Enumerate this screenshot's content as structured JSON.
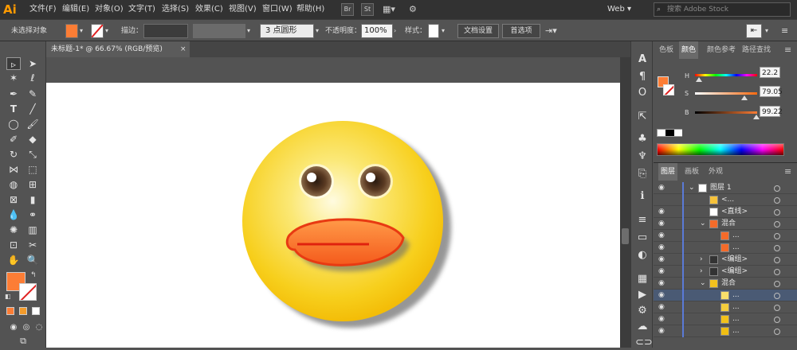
{
  "app": {
    "logo": "Ai"
  },
  "menu": [
    "文件(F)",
    "编辑(E)",
    "对象(O)",
    "文字(T)",
    "选择(S)",
    "效果(C)",
    "视图(V)",
    "窗口(W)",
    "帮助(H)"
  ],
  "menu_buttons": [
    "Br",
    "St"
  ],
  "workspace": "Web",
  "search_placeholder": "搜索 Adobe Stock",
  "control": {
    "selection": "未选择对象",
    "stroke_label": "描边：",
    "brush_profile": "3 点圆形",
    "opacity_label": "不透明度：",
    "opacity_value": "100%",
    "style_label": "样式：",
    "doc_setup": "文档设置",
    "preferences": "首选项"
  },
  "doc_tab": "未标题-1* @ 66.67% (RGB/预览)",
  "color_panel": {
    "tabs": [
      "色板",
      "颜色",
      "颜色参考",
      "路径查找"
    ],
    "H": {
      "label": "H",
      "value": "22.2",
      "pos": 0.06
    },
    "S": {
      "label": "S",
      "value": "79.05",
      "pos": 0.79
    },
    "B": {
      "label": "B",
      "value": "99.22",
      "pos": 0.99
    },
    "fill_color": "#fc7d35"
  },
  "layers_panel": {
    "tabs": [
      "图层",
      "画板",
      "外观"
    ],
    "rows": [
      {
        "name": "图层 1",
        "indent": 0,
        "expand": "v",
        "thumb": "#ffffff",
        "eye": true
      },
      {
        "name": "<...",
        "indent": 1,
        "expand": "",
        "thumb": "#f6c23a",
        "eye": false
      },
      {
        "name": "<直线>",
        "indent": 1,
        "expand": "",
        "thumb": "#ffffff",
        "eye": true
      },
      {
        "name": "混合",
        "indent": 1,
        "expand": "v",
        "thumb": "#f46b2a",
        "eye": true
      },
      {
        "name": "...",
        "indent": 2,
        "expand": "",
        "thumb": "#f46b2a",
        "eye": true
      },
      {
        "name": "...",
        "indent": 2,
        "expand": "",
        "thumb": "#f46b2a",
        "eye": true
      },
      {
        "name": "<编组>",
        "indent": 1,
        "expand": ">",
        "thumb": "#333333",
        "eye": true
      },
      {
        "name": "<编组>",
        "indent": 1,
        "expand": ">",
        "thumb": "#333333",
        "eye": true
      },
      {
        "name": "混合",
        "indent": 1,
        "expand": "v",
        "thumb": "#f4c21e",
        "eye": true
      },
      {
        "name": "...",
        "indent": 2,
        "expand": "",
        "thumb": "#f9df6b",
        "eye": true
      },
      {
        "name": "...",
        "indent": 2,
        "expand": "",
        "thumb": "#f4cd3c",
        "eye": true
      },
      {
        "name": "...",
        "indent": 2,
        "expand": "",
        "thumb": "#f2c21a",
        "eye": true
      },
      {
        "name": "...",
        "indent": 2,
        "expand": "",
        "thumb": "#f0be12",
        "eye": true
      }
    ]
  }
}
